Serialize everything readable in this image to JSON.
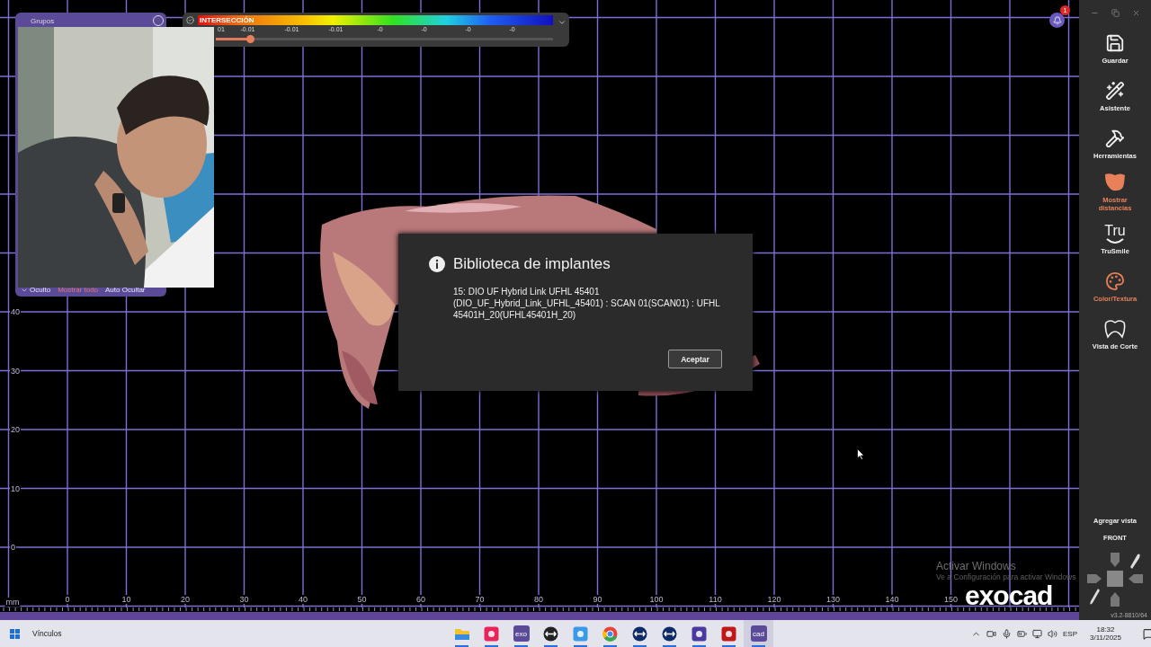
{
  "viewport": {
    "axis_unit": "mm",
    "x_ticks": [
      "0",
      "10",
      "20",
      "30",
      "40",
      "50",
      "60",
      "70",
      "80",
      "90",
      "100",
      "110",
      "120",
      "130",
      "140",
      "150"
    ],
    "y_ticks": [
      "40",
      "30",
      "20",
      "10",
      "0"
    ]
  },
  "groups_panel": {
    "title": "Grupos",
    "footer": [
      {
        "label": "Oculto",
        "kind": "dropdown"
      },
      {
        "label": "Mostrar todo",
        "kind": "link"
      },
      {
        "label": "Auto Ocultar",
        "kind": "toggle"
      }
    ]
  },
  "color_scale": {
    "title": "INTERSECCIÓN",
    "ticks": [
      "01",
      "-0.01",
      "-0.01",
      "-0.01",
      "-0",
      "-0",
      "-0",
      "-0"
    ],
    "level": 0.1
  },
  "notifications": {
    "count": "1"
  },
  "dialog": {
    "title": "Biblioteca de implantes",
    "lines": [
      "15: DIO UF Hybrid Link UFHL 45401",
      "(DIO_UF_Hybrid_Link_UFHL_45401) : SCAN 01(SCAN01) : UFHL 45401H_20(UFHL45401H_20)"
    ],
    "button": "Aceptar"
  },
  "sidebar": {
    "items": [
      {
        "label": "Guardar",
        "active": false
      },
      {
        "label": "Asistente",
        "active": false
      },
      {
        "label": "Herramientas",
        "active": false
      },
      {
        "label": "Mostrar distancias",
        "active": true
      },
      {
        "label": "TruSmile",
        "logo_text": "Tru",
        "active": false
      },
      {
        "label": "Color/Textura",
        "active": true
      },
      {
        "label": "Vista de Corte",
        "active": false
      }
    ],
    "add_view": "Agregar vista",
    "view_name": "FRONT",
    "version": "v3.2-8810/64"
  },
  "logo": "exocad",
  "activation_notice": {
    "title": "Activar Windows",
    "message": "Ve a Configuración para activar Windows"
  },
  "taskbar": {
    "links_label": "Vínculos",
    "apps": [
      {
        "running": true,
        "selected": false
      },
      {
        "running": true,
        "selected": false
      },
      {
        "label": "exo",
        "running": true,
        "selected": false
      },
      {
        "running": true,
        "selected": false
      },
      {
        "running": true,
        "selected": false
      },
      {
        "running": true,
        "selected": false
      },
      {
        "running": true,
        "selected": false
      },
      {
        "running": true,
        "selected": false
      },
      {
        "running": true,
        "selected": false
      },
      {
        "running": true,
        "selected": false
      },
      {
        "label": "cad",
        "running": true,
        "selected": true
      }
    ],
    "language": "ESP",
    "time": "18:32",
    "date": "3/11/2025"
  }
}
